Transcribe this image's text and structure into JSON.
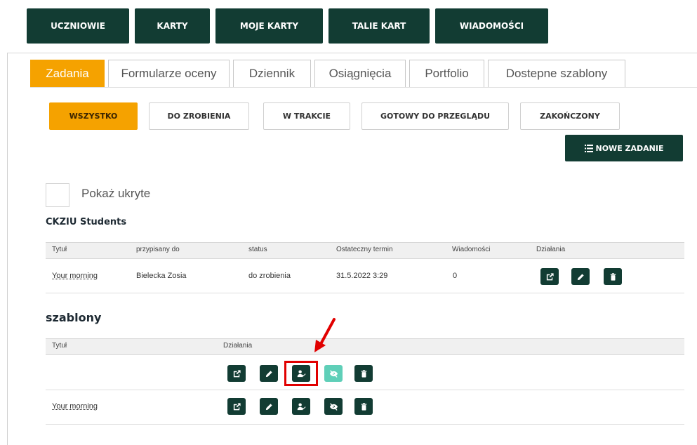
{
  "topnav": [
    "UCZNIOWIE",
    "KARTY",
    "MOJE KARTY",
    "TALIE KART",
    "WIADOMOŚCI"
  ],
  "tabs": [
    "Zadania",
    "Formularze oceny",
    "Dziennik",
    "Osiągnięcia",
    "Portfolio",
    "Dostepne szablony"
  ],
  "filters": [
    "WSZYSTKO",
    "DO ZROBIENIA",
    "W TRAKCIE",
    "GOTOWY DO PRZEGLĄDU",
    "ZAKOŃCZONY"
  ],
  "new_task_label": "NOWE ZADANIE",
  "show_hidden_label": "Pokaż ukryte",
  "groups": {
    "students": {
      "title": "CKZIU Students",
      "columns": [
        "Tytuł",
        "przypisany do",
        "status",
        "Ostateczny termin",
        "Wiadomości",
        "Działania"
      ],
      "rows": [
        {
          "title": "Your morning",
          "assigned": "Bielecka Zosia",
          "status": "do zrobienia",
          "deadline": "31.5.2022 3:29",
          "messages": "0"
        }
      ]
    },
    "templates": {
      "title": "szablony",
      "columns": [
        "Tytuł",
        "Działania"
      ],
      "rows": [
        {
          "title": ""
        },
        {
          "title": "Your morning"
        }
      ]
    }
  },
  "icons": [
    "external-link-icon",
    "pencil-icon",
    "assign-user-icon",
    "eye-slash-icon",
    "trash-icon",
    "list-icon"
  ],
  "colors": {
    "primary": "#123c33",
    "accent": "#f5a200",
    "light_action": "#5fcfb8",
    "highlight": "#e10000"
  }
}
